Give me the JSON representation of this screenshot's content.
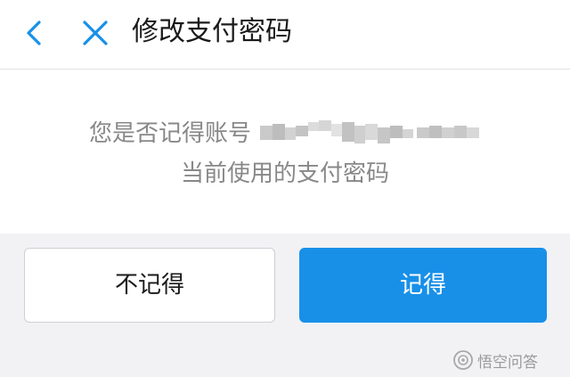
{
  "header": {
    "title": "修改支付密码",
    "back_icon": "chevron-left-icon",
    "close_icon": "close-icon",
    "accent_color": "#1890e8"
  },
  "prompt": {
    "line1_text": "您是否记得账号",
    "line2_text": "当前使用的支付密码"
  },
  "actions": {
    "forgot_label": "不记得",
    "remember_label": "记得"
  },
  "watermark": {
    "text": "悟空问答"
  }
}
